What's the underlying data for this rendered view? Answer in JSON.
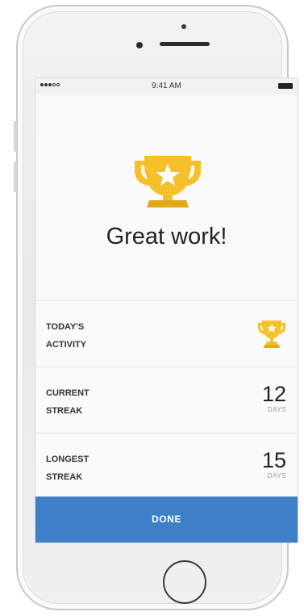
{
  "status_bar": {
    "time": "9:41 AM",
    "signal_icon": "signal-dots-icon",
    "battery_icon": "battery-icon"
  },
  "hero": {
    "icon": "trophy-star-icon",
    "headline": "Great work!"
  },
  "stats": [
    {
      "label_line1": "TODAY'S",
      "label_line2": "ACTIVITY",
      "icon": "trophy-icon"
    },
    {
      "label_line1": "CURRENT",
      "label_line2": "STREAK",
      "value": "12",
      "unit": "DAYS"
    },
    {
      "label_line1": "LONGEST",
      "label_line2": "STREAK",
      "value": "15",
      "unit": "DAYS"
    }
  ],
  "done_button": {
    "label": "DONE"
  },
  "colors": {
    "accent": "#3f7fc8",
    "trophy": "#f5c02a",
    "trophy_shade": "#e3a91c"
  }
}
